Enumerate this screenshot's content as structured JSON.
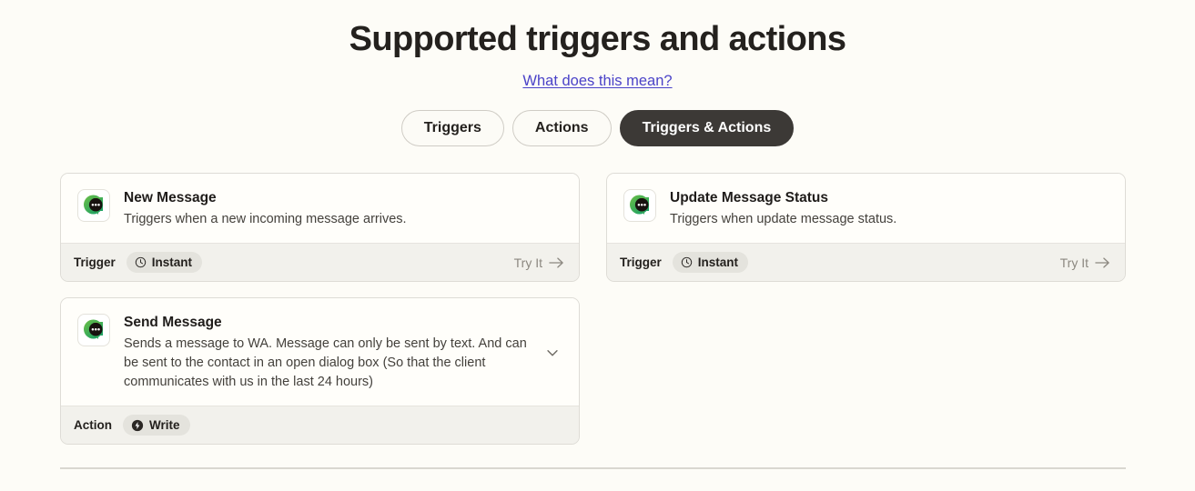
{
  "header": {
    "title": "Supported triggers and actions",
    "help_link": "What does this mean?",
    "link_color": "#4A42C8"
  },
  "filter_toggle": {
    "active_index": 2,
    "active_bg": "#3C3936",
    "options": [
      {
        "label": "Triggers",
        "active": false
      },
      {
        "label": "Actions",
        "active": false
      },
      {
        "label": "Triggers & Actions",
        "active": true
      }
    ]
  },
  "cards": [
    {
      "icon": "wa-chat-bubble-icon",
      "title": "New Message",
      "description": "Triggers when a new incoming message arrives.",
      "kind": "Trigger",
      "badge_label": "Instant",
      "badge_icon": "clock-icon",
      "try_it": "Try It",
      "expandable": false
    },
    {
      "icon": "wa-chat-bubble-icon",
      "title": "Update Message Status",
      "description": "Triggers when update message status.",
      "kind": "Trigger",
      "badge_label": "Instant",
      "badge_icon": "clock-icon",
      "try_it": "Try It",
      "expandable": false
    },
    {
      "icon": "wa-chat-bubble-icon",
      "title": "Send Message",
      "description": "Sends a message to WA. Message can only be sent by text. And can be sent to the contact in an open dialog box (So that the client communicates with us in the last 24 hours)",
      "kind": "Action",
      "badge_label": "Write",
      "badge_icon": "write-bolt-icon",
      "try_it": null,
      "expandable": true
    }
  ]
}
